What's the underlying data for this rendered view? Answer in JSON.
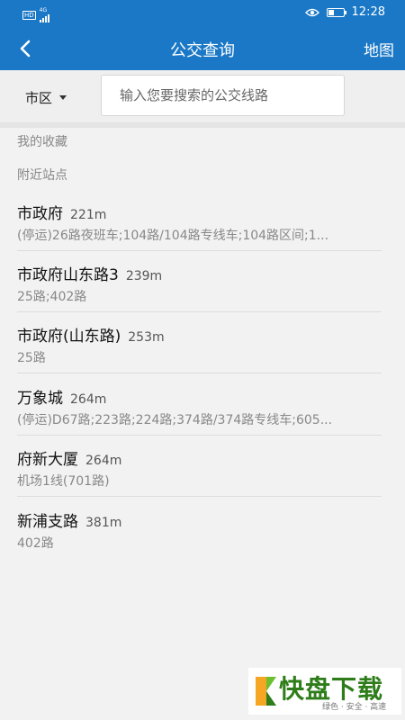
{
  "status_bar": {
    "hd_label": "HD",
    "network_label": "4G",
    "time": "12:28"
  },
  "header": {
    "title": "公交查询",
    "map_label": "地图"
  },
  "search": {
    "region": "市区",
    "placeholder": "输入您要搜索的公交线路"
  },
  "sections": {
    "favorites": "我的收藏",
    "nearby": "附近站点"
  },
  "stops": [
    {
      "name": "市政府",
      "distance": "221m",
      "routes": "(停运)26路夜班车;104路/104路专线车;104路区间;1..."
    },
    {
      "name": "市政府山东路3",
      "distance": "239m",
      "routes": "25路;402路"
    },
    {
      "name": "市政府(山东路)",
      "distance": "253m",
      "routes": "25路"
    },
    {
      "name": "万象城",
      "distance": "264m",
      "routes": "(停运)D67路;223路;224路;374路/374路专线车;605..."
    },
    {
      "name": "府新大厦",
      "distance": "264m",
      "routes": "机场1线(701路)"
    },
    {
      "name": "新浦支路",
      "distance": "381m",
      "routes": "402路"
    }
  ],
  "watermark": {
    "brand": "快盘下载",
    "slogan": "绿色 · 安全 · 高速"
  },
  "colors": {
    "primary": "#1b78c6",
    "background": "#f2f2f2"
  }
}
